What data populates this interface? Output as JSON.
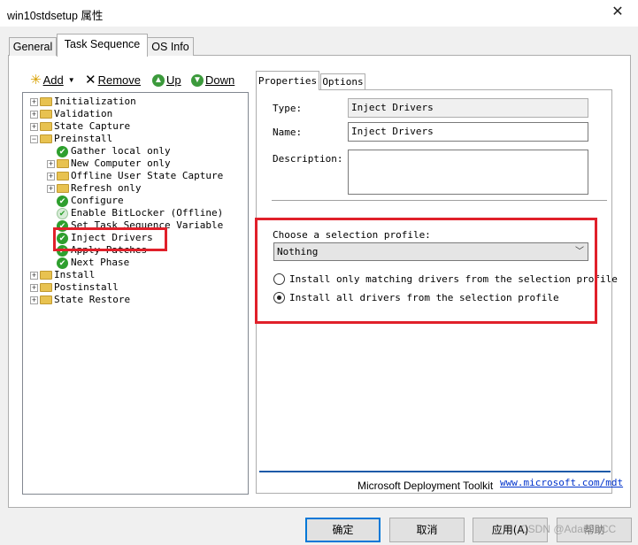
{
  "window": {
    "title": "win10stdsetup 属性",
    "close_glyph": "✕"
  },
  "tabs": [
    {
      "label": "General",
      "selected": false
    },
    {
      "label": "Task Sequence",
      "selected": true
    },
    {
      "label": "OS Info",
      "selected": false
    }
  ],
  "toolbar": {
    "add": "Add",
    "remove": "Remove",
    "up": "Up",
    "down": "Down"
  },
  "tree": [
    {
      "label": "Initialization",
      "level": 0,
      "icon": "folder",
      "expander": "+"
    },
    {
      "label": "Validation",
      "level": 0,
      "icon": "folder",
      "expander": "+"
    },
    {
      "label": "State Capture",
      "level": 0,
      "icon": "folder",
      "expander": "+"
    },
    {
      "label": "Preinstall",
      "level": 0,
      "icon": "folder",
      "expander": "-"
    },
    {
      "label": "Gather local only",
      "level": 1,
      "icon": "check",
      "expander": ""
    },
    {
      "label": "New Computer only",
      "level": 1,
      "icon": "folder",
      "expander": "+"
    },
    {
      "label": "Offline User State Capture",
      "level": 1,
      "icon": "folder",
      "expander": "+"
    },
    {
      "label": "Refresh only",
      "level": 1,
      "icon": "folder",
      "expander": "+"
    },
    {
      "label": "Configure",
      "level": 1,
      "icon": "check",
      "expander": ""
    },
    {
      "label": "Enable BitLocker (Offline)",
      "level": 1,
      "icon": "check-dim",
      "expander": ""
    },
    {
      "label": "Set Task Sequence Variable",
      "level": 1,
      "icon": "check",
      "expander": ""
    },
    {
      "label": "Inject Drivers",
      "level": 1,
      "icon": "check",
      "expander": ""
    },
    {
      "label": "Apply Patches",
      "level": 1,
      "icon": "check",
      "expander": ""
    },
    {
      "label": "Next Phase",
      "level": 1,
      "icon": "check",
      "expander": ""
    },
    {
      "label": "Install",
      "level": 0,
      "icon": "folder",
      "expander": "+"
    },
    {
      "label": "Postinstall",
      "level": 0,
      "icon": "folder",
      "expander": "+"
    },
    {
      "label": "State Restore",
      "level": 0,
      "icon": "folder",
      "expander": "+"
    }
  ],
  "properties": {
    "tabs": [
      "Properties",
      "Options"
    ],
    "type_label": "Type:",
    "type_value": "Inject Drivers",
    "name_label": "Name:",
    "name_value": "Inject Drivers",
    "description_label": "Description:",
    "description_value": "",
    "profile_label": "Choose a selection profile:",
    "profile_value": "Nothing",
    "radio_matching": "Install only matching drivers from the selection profile",
    "radio_all": "Install all drivers from the selection profile",
    "selected_radio": "all"
  },
  "footer": {
    "product": "Microsoft Deployment Toolkit",
    "link": "www.microsoft.com/mdt"
  },
  "buttons": {
    "ok": "确定",
    "cancel": "取消",
    "apply": "应用(A)",
    "help": "帮助"
  },
  "watermark": "CSDN @AdamInCC"
}
